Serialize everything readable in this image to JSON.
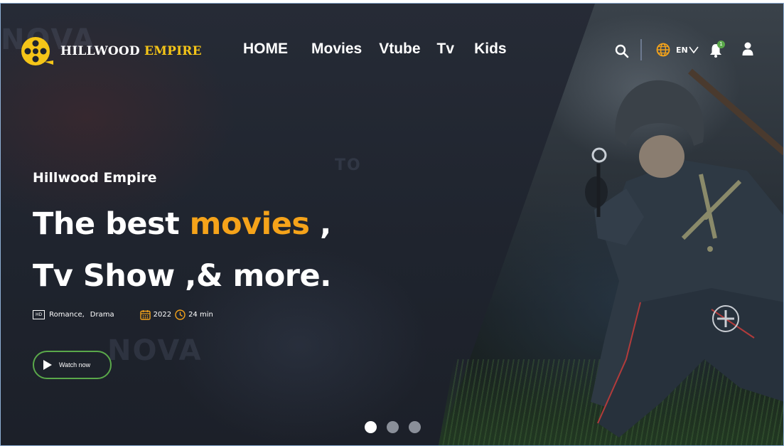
{
  "brand": {
    "name_part1": "HILLWOOD",
    "name_part2": "EMPIRE",
    "accent_color": "#f5c518",
    "icon": "film-reel-icon"
  },
  "nav": {
    "items": [
      {
        "label": "HOME"
      },
      {
        "label": "Movies"
      },
      {
        "label": "Vtube"
      },
      {
        "label": "Tv"
      },
      {
        "label": "Kids"
      }
    ]
  },
  "header_actions": {
    "search_icon": "search-icon",
    "language_icon": "globe-icon",
    "language_code": "EN",
    "language_chevron": "chevron-down-icon",
    "notification_icon": "bell-icon",
    "notification_count": "1",
    "user_icon": "user-icon"
  },
  "hero": {
    "subtitle": "Hillwood Empire",
    "headline_line1_start": "The best",
    "headline_line1_highlight": "movies",
    "headline_line1_end": ",",
    "headline_line2": "Tv Show ,& more.",
    "highlight_color": "#f5a31a",
    "meta": {
      "quality_badge": "HD",
      "genres": [
        "Romance,",
        "Drama"
      ],
      "year_icon": "calendar-icon",
      "year": "2022",
      "duration_icon": "clock-icon",
      "duration": "24 min"
    },
    "watch_button": {
      "label": "Watch now",
      "icon": "play-icon",
      "border_color": "#5aa84a"
    }
  },
  "carousel": {
    "slide_count": 3,
    "active_index": 0
  },
  "colors": {
    "background": "#202530",
    "badge_green": "#5aa84a"
  }
}
